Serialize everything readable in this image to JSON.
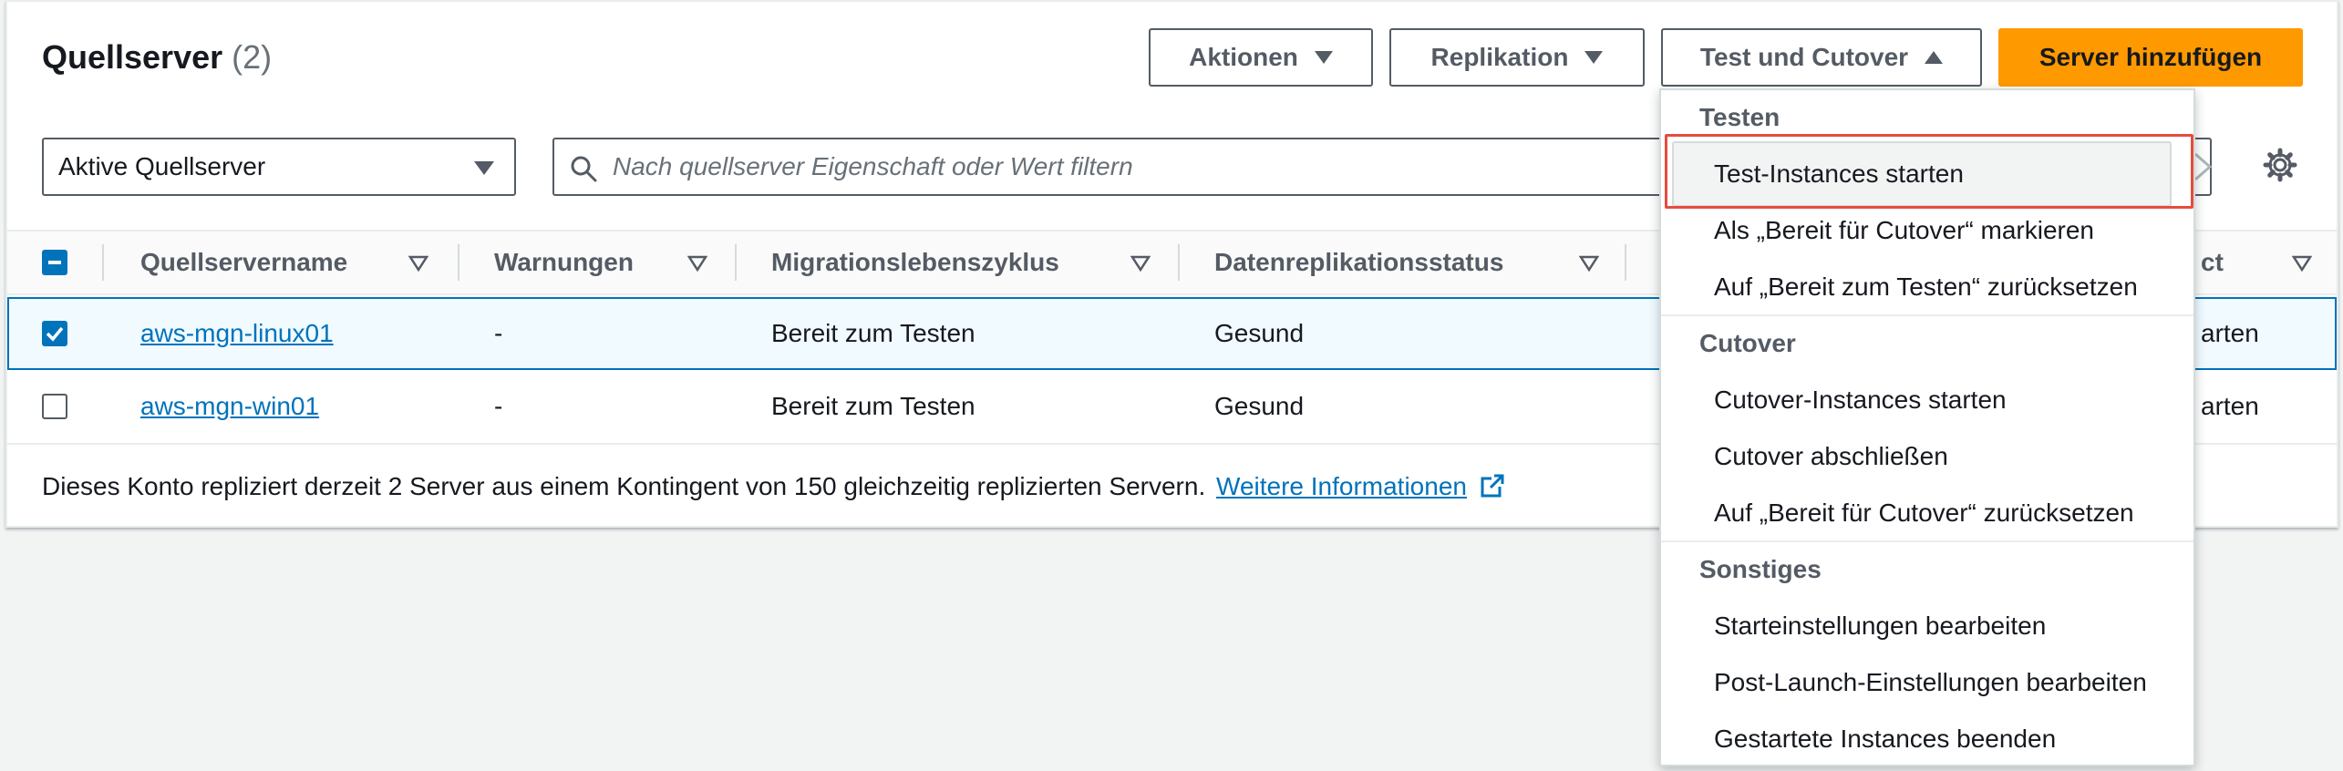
{
  "header": {
    "title": "Quellserver",
    "count": "(2)",
    "actions_label": "Aktionen",
    "replication_label": "Replikation",
    "test_cutover_label": "Test und Cutover",
    "add_server_label": "Server hinzufügen"
  },
  "filter": {
    "select_value": "Aktive Quellserver",
    "search_placeholder": "Nach quellserver Eigenschaft oder Wert filtern"
  },
  "table": {
    "columns": [
      "Quellservername",
      "Warnungen",
      "Migrationslebenszyklus",
      "Datenreplikationsstatus",
      "ct"
    ],
    "rows": [
      {
        "selected": true,
        "name": "aws-mgn-linux01",
        "warnings": "-",
        "lifecycle": "Bereit zum Testen",
        "replication": "Gesund",
        "next": "arten"
      },
      {
        "selected": false,
        "name": "aws-mgn-win01",
        "warnings": "-",
        "lifecycle": "Bereit zum Testen",
        "replication": "Gesund",
        "next": "arten"
      }
    ]
  },
  "footer": {
    "text": "Dieses Konto repliziert derzeit 2 Server aus einem Kontingent von 150 gleichzeitig replizierten Servern.",
    "link": "Weitere Informationen"
  },
  "dropdown": {
    "groups": [
      {
        "label": "Testen",
        "items": [
          "Test-Instances starten",
          "Als „Bereit für Cutover“ markieren",
          "Auf „Bereit zum Testen“ zurücksetzen"
        ]
      },
      {
        "label": "Cutover",
        "items": [
          "Cutover-Instances starten",
          "Cutover abschließen",
          "Auf „Bereit für Cutover“ zurücksetzen"
        ]
      },
      {
        "label": "Sonstiges",
        "items": [
          "Starteinstellungen bearbeiten",
          "Post-Launch-Einstellungen bearbeiten",
          "Gestartete Instances beenden"
        ]
      }
    ]
  },
  "colors": {
    "primary": "#ff9900",
    "link": "#0073bb",
    "highlight_outline": "#e74c3c"
  }
}
